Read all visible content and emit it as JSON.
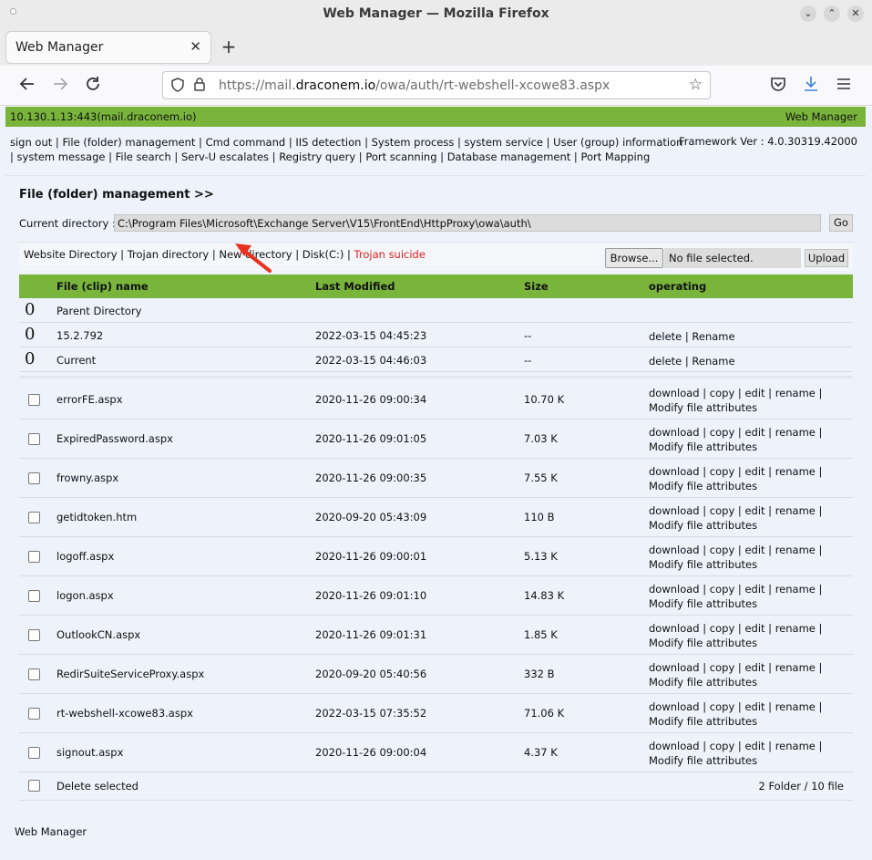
{
  "browser": {
    "window_title": "Web Manager — Mozilla Firefox",
    "tab_title": "Web Manager",
    "url_prefix": "https://mail.",
    "url_host": "draconem.io",
    "url_path": "/owa/auth/rt-webshell-xcowe83.aspx"
  },
  "topbar": {
    "host": "10.130.1.13:443(mail.draconem.io)",
    "brand": "Web Manager"
  },
  "menu": {
    "items": [
      "sign out",
      "File (folder) management",
      "Cmd command",
      "IIS detection",
      "System process",
      "system service",
      "User (group) information",
      "system message",
      "File search",
      "Serv-U escalates",
      "Registry query",
      "Port scanning",
      "Database management",
      "Port Mapping"
    ],
    "framework": "Framework Ver : 4.0.30319.42000"
  },
  "panel": {
    "heading": "File (folder) management >>",
    "current_dir_label": "Current directory :",
    "current_dir_value": "C:\\Program Files\\Microsoft\\Exchange Server\\V15\\FrontEnd\\HttpProxy\\owa\\auth\\",
    "go_label": "Go",
    "dir_links": [
      "Website Directory",
      "Trojan directory",
      "New directory",
      "Disk(C:)"
    ],
    "trojan_suicide": "Trojan suicide",
    "browse_label": "Browse...",
    "no_file_label": "No file selected.",
    "upload_label": "Upload"
  },
  "table": {
    "headers": [
      "File (clip) name",
      "Last Modified",
      "Size",
      "operating"
    ],
    "folders": [
      {
        "marker": "0",
        "name": "Parent Directory",
        "modified": "",
        "size": "",
        "ops": ""
      },
      {
        "marker": "0",
        "name": "15.2.792",
        "modified": "2022-03-15 04:45:23",
        "size": "--",
        "ops": "delete | Rename"
      },
      {
        "marker": "0",
        "name": "Current",
        "modified": "2022-03-15 04:46:03",
        "size": "--",
        "ops": "delete | Rename"
      }
    ],
    "file_ops": "download | copy | edit | rename | Modify file attributes",
    "files": [
      {
        "name": "errorFE.aspx",
        "modified": "2020-11-26 09:00:34",
        "size": "10.70 K"
      },
      {
        "name": "ExpiredPassword.aspx",
        "modified": "2020-11-26 09:01:05",
        "size": "7.03 K"
      },
      {
        "name": "frowny.aspx",
        "modified": "2020-11-26 09:00:35",
        "size": "7.55 K"
      },
      {
        "name": "getidtoken.htm",
        "modified": "2020-09-20 05:43:09",
        "size": "110 B"
      },
      {
        "name": "logoff.aspx",
        "modified": "2020-11-26 09:00:01",
        "size": "5.13 K"
      },
      {
        "name": "logon.aspx",
        "modified": "2020-11-26 09:01:10",
        "size": "14.83 K"
      },
      {
        "name": "OutlookCN.aspx",
        "modified": "2020-11-26 09:01:31",
        "size": "1.85 K"
      },
      {
        "name": "RedirSuiteServiceProxy.aspx",
        "modified": "2020-09-20 05:40:56",
        "size": "332 B"
      },
      {
        "name": "rt-webshell-xcowe83.aspx",
        "modified": "2022-03-15 07:35:52",
        "size": "71.06 K"
      },
      {
        "name": "signout.aspx",
        "modified": "2020-11-26 09:00:04",
        "size": "4.37 K"
      }
    ],
    "delete_selected": "Delete selected",
    "summary": "2 Folder / 10 file"
  },
  "footer": {
    "brand": "Web Manager"
  },
  "colors": {
    "green_bar": "#7ab53b",
    "page_bg": "#edf2fb",
    "danger": "#e02020",
    "annotation_arrow": "#e8321e"
  },
  "icons": [
    "back-arrow-icon",
    "forward-arrow-icon",
    "reload-icon",
    "shield-icon",
    "lock-icon",
    "star-icon",
    "pocket-icon",
    "download-icon",
    "hamburger-menu-icon",
    "red-pointer-arrow"
  ]
}
